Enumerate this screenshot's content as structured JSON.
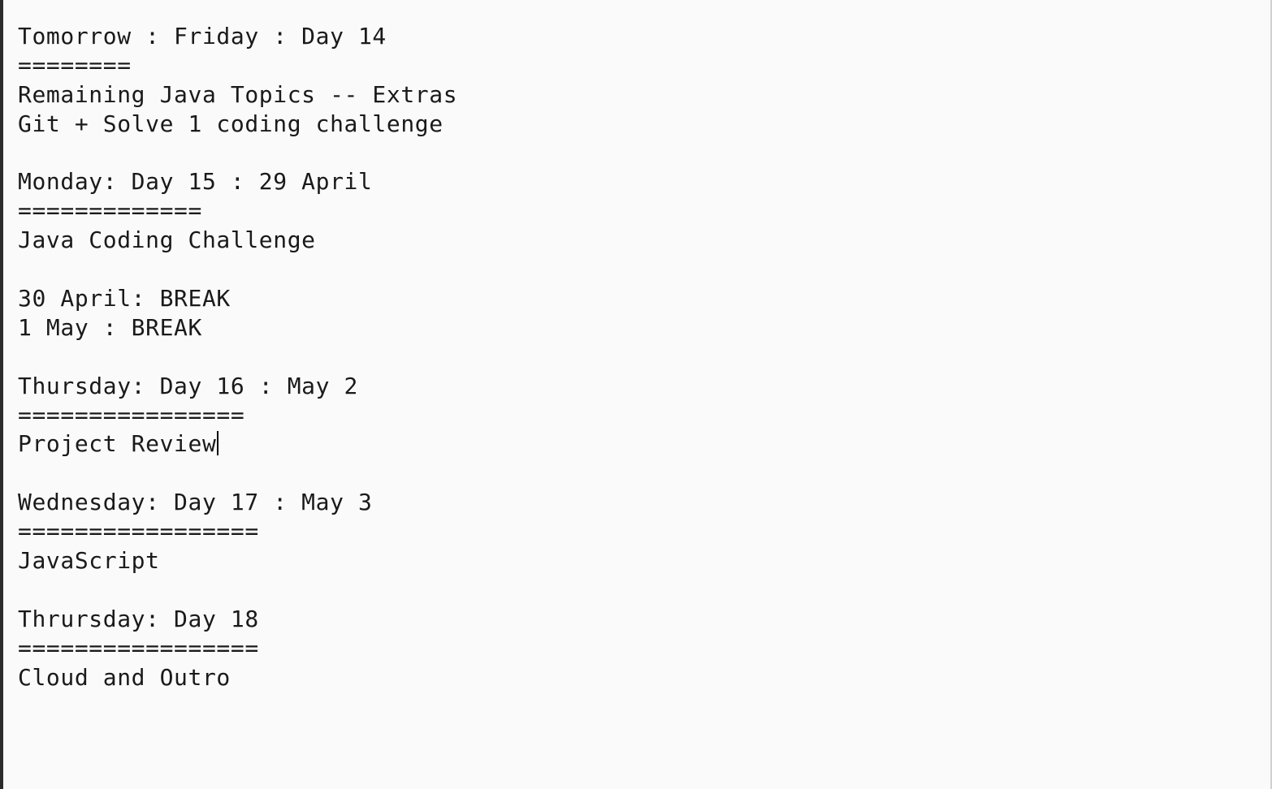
{
  "document": {
    "lines": [
      "Tomorrow : Friday : Day 14",
      "========",
      "Remaining Java Topics -- Extras",
      "Git + Solve 1 coding challenge",
      "",
      "Monday: Day 15 : 29 April",
      "=============",
      "Java Coding Challenge",
      "",
      "30 April: BREAK",
      "1 May : BREAK",
      "",
      "Thursday: Day 16 : May 2",
      "================",
      "Project Review",
      "",
      "Wednesday: Day 17 : May 3",
      "=================",
      "JavaScript",
      "",
      "Thrursday: Day 18",
      "=================",
      "Cloud and Outro"
    ]
  }
}
